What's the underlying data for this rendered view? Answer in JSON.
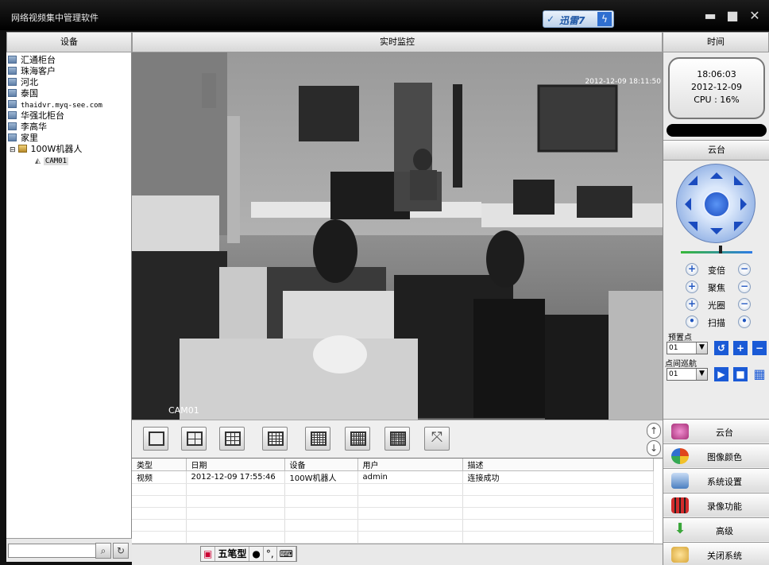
{
  "window": {
    "title": "网络视频集中管理软件"
  },
  "taskbar_badge": {
    "label": "迅雷7"
  },
  "headers": {
    "device": "设备",
    "live": "实时监控",
    "time": "时间"
  },
  "tree": {
    "items": [
      {
        "label": "汇通柜台"
      },
      {
        "label": "珠海客户"
      },
      {
        "label": "河北"
      },
      {
        "label": "泰国"
      },
      {
        "label": "thaidvr.myq-see.com"
      },
      {
        "label": "华强北柜台"
      },
      {
        "label": "李高华"
      },
      {
        "label": "家里"
      },
      {
        "label": "100W机器人",
        "expander": "⊟"
      },
      {
        "label": "CAM01"
      }
    ]
  },
  "video": {
    "timestamp": "2012-12-09 18:11:50",
    "camera_label": "CAM01"
  },
  "clock": {
    "time": "18:06:03",
    "date": "2012-12-09",
    "cpu": "CPU : 16%"
  },
  "ptz": {
    "header": "云台",
    "zoom": "变倍",
    "focus": "聚焦",
    "iris": "光圈",
    "scan": "扫描",
    "preset_label": "预置点",
    "preset_value": "01",
    "cruise_label": "点间巡航",
    "cruise_value": "01"
  },
  "log": {
    "columns": [
      "类型",
      "日期",
      "设备",
      "用户",
      "描述"
    ],
    "rows": [
      [
        "视频",
        "2012-12-09 17:55:46",
        "100W机器人",
        "admin",
        "连接成功"
      ]
    ]
  },
  "menu": [
    {
      "label": "云台",
      "icon": "ptz-icon",
      "color": "#c04a9a"
    },
    {
      "label": "图像颜色",
      "icon": "color-palette-icon",
      "color": "#e0461c"
    },
    {
      "label": "系统设置",
      "icon": "settings-icon",
      "color": "#4a7fc0"
    },
    {
      "label": "录像功能",
      "icon": "film-icon",
      "color": "#d32c2c"
    },
    {
      "label": "高级",
      "icon": "arrow-down-icon",
      "color": "#3aa63a"
    },
    {
      "label": "关闭系统",
      "icon": "users-icon",
      "color": "#d8a73a"
    }
  ],
  "ime": {
    "name": "五笔型",
    "icon": "ime-icon"
  }
}
